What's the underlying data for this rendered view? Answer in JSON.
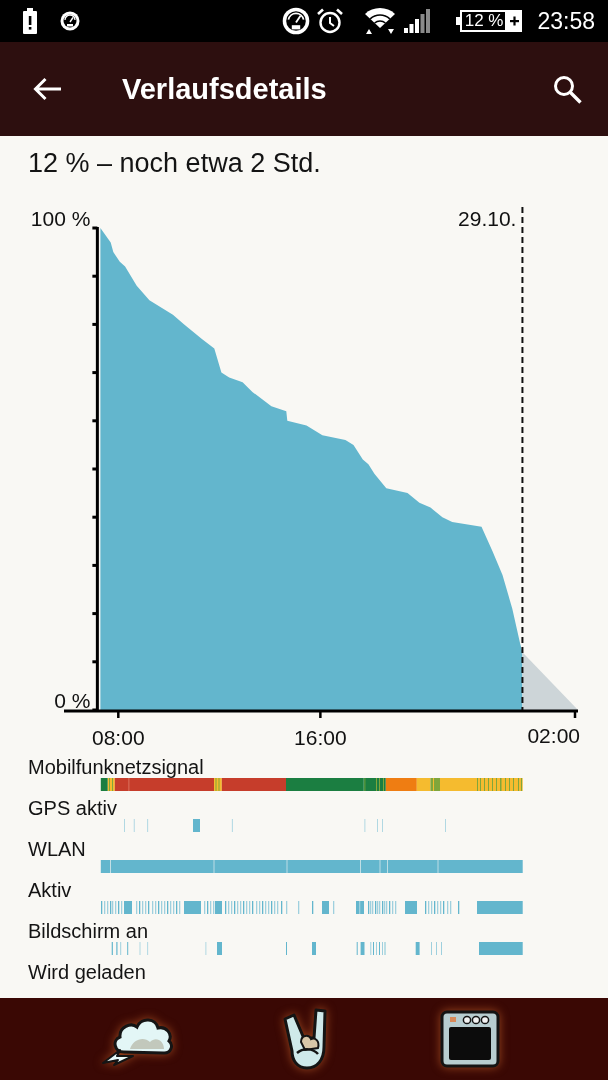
{
  "status_bar": {
    "battery": "12 %",
    "charging": true,
    "time": "23:58"
  },
  "app_bar": {
    "title": "Verlaufsdetails"
  },
  "summary": "12 % – noch etwa 2 Std.",
  "battery_chart": {
    "chart_data": {
      "type": "area",
      "x": [
        7.29,
        7.7,
        7.8,
        8.06,
        8.27,
        8.73,
        9.23,
        10.16,
        10.61,
        11.31,
        11.8,
        12.08,
        12.39,
        12.92,
        13.31,
        14.06,
        14.65,
        14.69,
        15.45,
        16.08,
        16.99,
        17.31,
        17.68,
        17.9,
        18.14,
        18.61,
        19.45,
        19.92,
        20.36,
        20.83,
        21.22,
        22.38,
        22.81,
        23.21,
        23.6,
        23.9,
        24,
        26.2
      ],
      "series": [
        {
          "color": "#63b6cd",
          "values": [
            100,
            97,
            95,
            93,
            92,
            88,
            85,
            82,
            80,
            77,
            75,
            70,
            69,
            68,
            66,
            63,
            62,
            60,
            59,
            57,
            56,
            55,
            52,
            51,
            49,
            46,
            45,
            43,
            42,
            40,
            39,
            38,
            33,
            28,
            21,
            14,
            12,
            null
          ]
        },
        {
          "color": "#cdd5d8",
          "values": [
            null,
            null,
            null,
            null,
            null,
            null,
            null,
            null,
            null,
            null,
            null,
            null,
            null,
            null,
            null,
            null,
            null,
            null,
            null,
            null,
            null,
            null,
            null,
            null,
            null,
            null,
            null,
            null,
            null,
            null,
            null,
            null,
            null,
            null,
            null,
            null,
            12,
            0
          ]
        }
      ],
      "xlim": [
        5.85,
        26.2
      ],
      "ylim": [
        0,
        100
      ],
      "xticks": [
        {
          "value": 8,
          "label": "08:00"
        },
        {
          "value": 16,
          "label": "16:00"
        }
      ],
      "yticks": [
        {
          "value": 0,
          "label": "0 %"
        },
        {
          "value": 100,
          "label": "100 %"
        }
      ],
      "ref_lines": [
        {
          "axis": "x",
          "value": 24
        }
      ],
      "annotations": [
        "29.10."
      ]
    },
    "next_day_tick_label": "02:00"
  },
  "timelines": [
    {
      "label": "Mobilfunknetzsignal",
      "kind": "signal"
    },
    {
      "label": "GPS aktiv",
      "kind": "activity"
    },
    {
      "label": "WLAN",
      "kind": "activity"
    },
    {
      "label": "Aktiv",
      "kind": "activity"
    },
    {
      "label": "Bildschirm an",
      "kind": "activity"
    },
    {
      "label": "Wird geladen",
      "kind": "activity"
    }
  ]
}
